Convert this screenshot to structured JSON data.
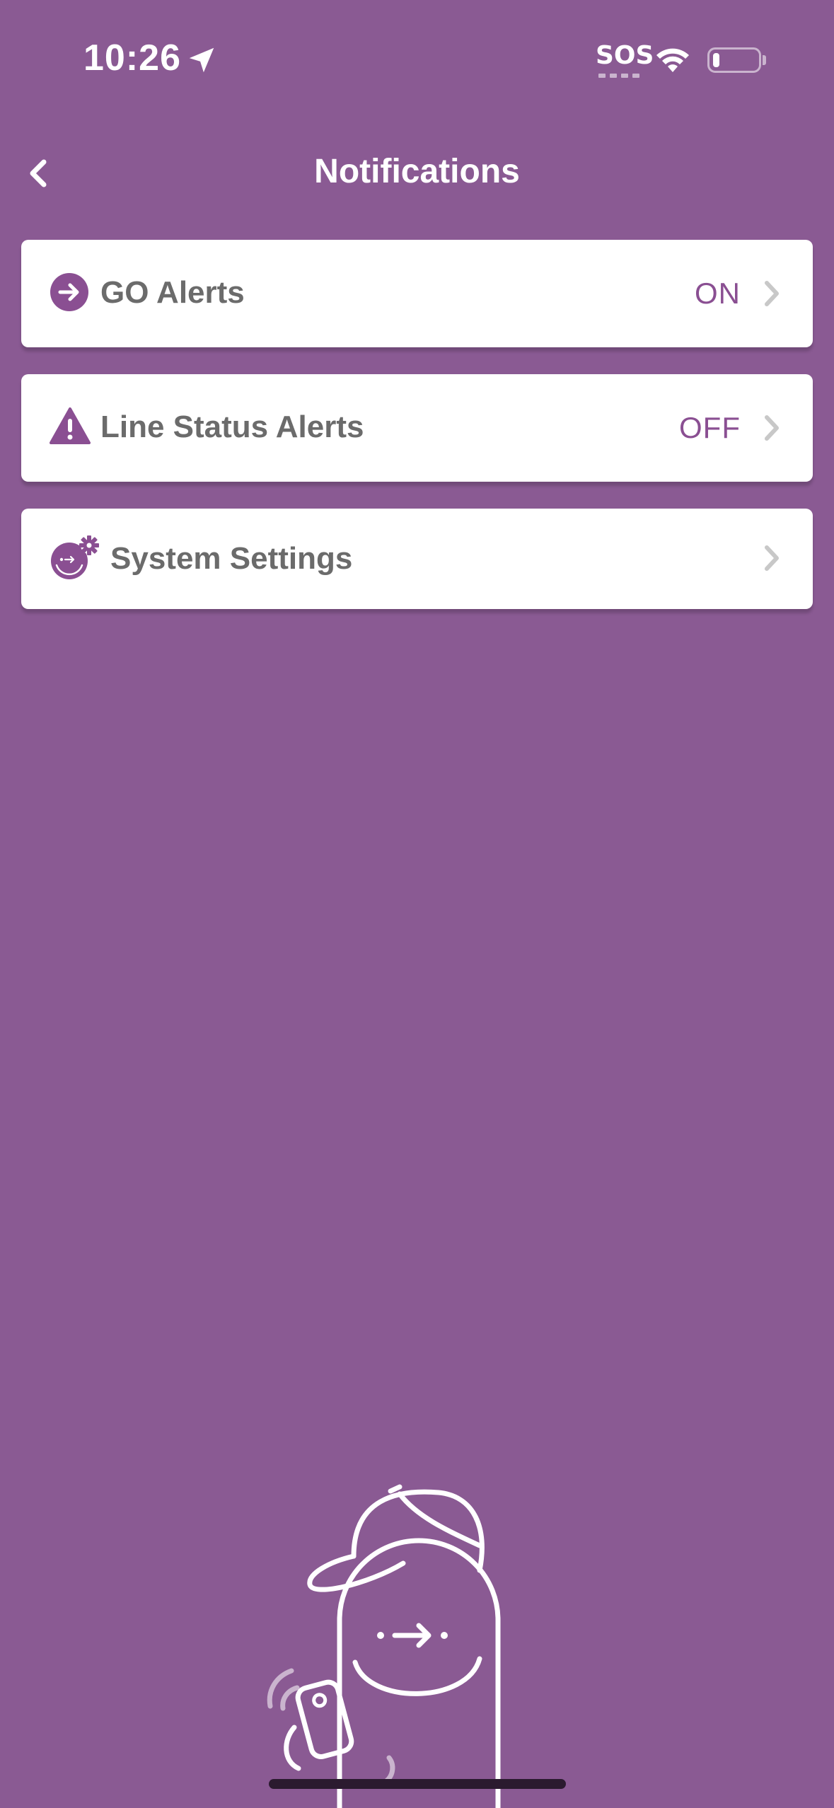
{
  "status_bar": {
    "time": "10:26",
    "sos": "SOS",
    "icons": [
      "location-arrow-icon",
      "wifi-icon",
      "battery-icon"
    ],
    "battery_level": 0.15
  },
  "header": {
    "back_icon": "chevron-left-icon",
    "title": "Notifications"
  },
  "rows": [
    {
      "label": "GO Alerts",
      "value": "ON",
      "icon": "arrow-circle-icon",
      "chevron": "chevron-right-icon"
    },
    {
      "label": "Line Status Alerts",
      "value": "OFF",
      "icon": "warning-triangle-icon",
      "chevron": "chevron-right-icon"
    },
    {
      "label": "System Settings",
      "value": "",
      "icon": "face-gear-icon",
      "chevron": "chevron-right-icon"
    }
  ],
  "colors": {
    "background": "#8a5a93",
    "accent": "#8a4f92",
    "label": "#6b6b6b",
    "chevron": "#c8c8c8",
    "card": "#ffffff"
  },
  "illustration": "mascot-with-phone-illustration"
}
